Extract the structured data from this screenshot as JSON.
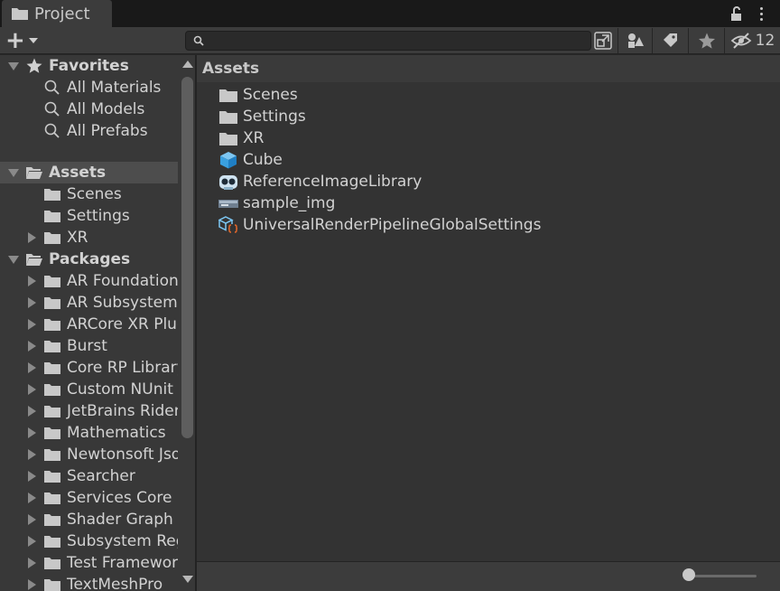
{
  "window": {
    "tab_title": "Project"
  },
  "toolbar": {
    "search_value": "",
    "search_placeholder": "",
    "hidden_packages_count": "12"
  },
  "sidebar": {
    "favorites": {
      "label": "Favorites",
      "items": [
        "All Materials",
        "All Models",
        "All Prefabs"
      ]
    },
    "assets": {
      "label": "Assets",
      "items": [
        "Scenes",
        "Settings",
        "XR"
      ]
    },
    "packages": {
      "label": "Packages",
      "items": [
        "AR Foundation",
        "AR Subsystems",
        "ARCore XR Plugin",
        "Burst",
        "Core RP Library",
        "Custom NUnit",
        "JetBrains Rider Editor",
        "Mathematics",
        "Newtonsoft Json",
        "Searcher",
        "Services Core",
        "Shader Graph",
        "Subsystem Registration",
        "Test Framework",
        "TextMeshPro"
      ]
    }
  },
  "main": {
    "breadcrumb": "Assets",
    "assets": [
      {
        "name": "Scenes",
        "icon": "folder-icon"
      },
      {
        "name": "Settings",
        "icon": "folder-icon"
      },
      {
        "name": "XR",
        "icon": "folder-icon"
      },
      {
        "name": "Cube",
        "icon": "cube-icon"
      },
      {
        "name": "ReferenceImageLibrary",
        "icon": "scriptable-object-icon"
      },
      {
        "name": "sample_img",
        "icon": "texture-icon"
      },
      {
        "name": "UniversalRenderPipelineGlobalSettings",
        "icon": "settings-asset-icon"
      }
    ]
  },
  "colors": {
    "background": "#282828",
    "panel": "#383838",
    "selected_row": "#4d4d4d",
    "cube_blue": "#3aa0e0",
    "accent_orange": "#e0662a"
  }
}
